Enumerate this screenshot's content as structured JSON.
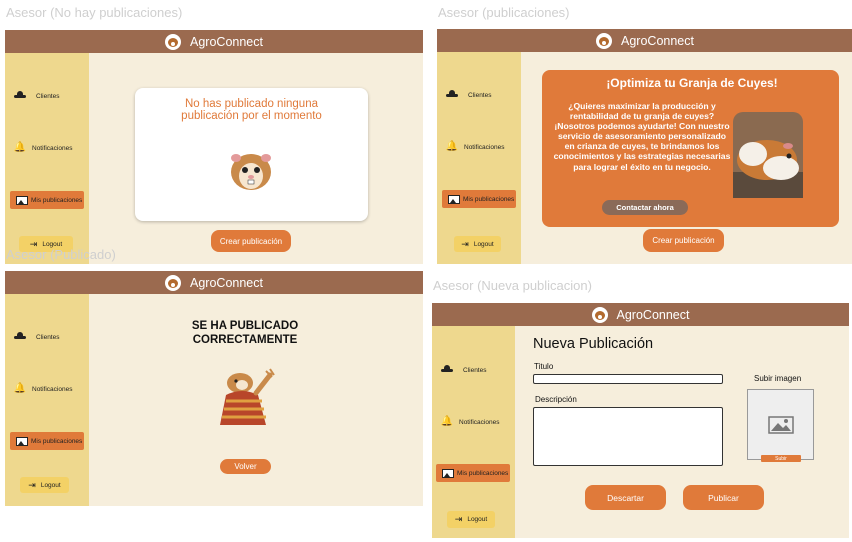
{
  "app": {
    "name": "AgroConnect"
  },
  "frames": {
    "no_posts": {
      "title": "Asesor (No hay publicaciones)"
    },
    "posts": {
      "title": "Asesor (publicaciones)"
    },
    "published": {
      "title": "Asesor (Publicado)"
    },
    "new_post": {
      "title": "Asesor (Nueva publicacion)"
    }
  },
  "sidebar": {
    "clients": "Clientes",
    "notifications": "Notificaciones",
    "my_posts": "Mis publicaciones",
    "logout": "Logout"
  },
  "no_posts": {
    "message": "No has publicado ninguna publicación por el momento",
    "create_button": "Crear publicación"
  },
  "posts": {
    "card_title": "¡Optimiza tu Granja de Cuyes!",
    "card_body": "¿Quieres maximizar la producción y rentabilidad de tu granja de cuyes? ¡Nosotros podemos ayudarte! Con nuestro servicio de asesoramiento personalizado en crianza de cuyes, te brindamos los conocimientos y las estrategias necesarias para lograr el éxito en tu negocio.",
    "contact_button": "Contactar ahora",
    "create_button": "Crear publicación"
  },
  "published": {
    "message_line1": "SE HA PUBLICADO",
    "message_line2": "CORRECTAMENTE",
    "back_button": "Volver"
  },
  "new_post": {
    "heading": "Nueva Publicación",
    "title_label": "Titulo",
    "title_value": "",
    "description_label": "Descripción",
    "description_value": "",
    "upload_image_label": "Subir imagen",
    "upload_button": "Subir",
    "discard_button": "Descartar",
    "publish_button": "Publicar"
  },
  "colors": {
    "header": "#9b6a4f",
    "sidebar": "#eed88e",
    "content_bg": "#f6eedc",
    "accent": "#e07a3a",
    "logout_bg": "#f3d166"
  },
  "icons": [
    "cowboy-hat-icon",
    "bell-icon",
    "image-icon",
    "logout-icon",
    "guinea-pig-logo",
    "image-placeholder-icon"
  ]
}
